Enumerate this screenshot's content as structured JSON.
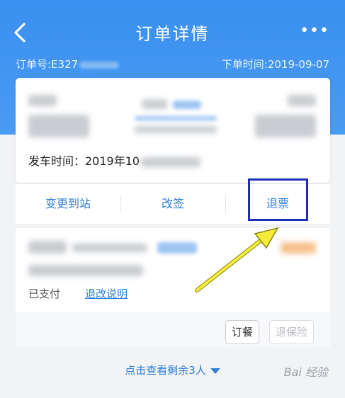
{
  "header": {
    "title": "订单详情",
    "more": "•••",
    "order_no_label": "订单号:E327",
    "order_time_label": "下单时间:2019-09-07"
  },
  "card": {
    "departure_label": "发车时间：2019年10"
  },
  "actions": {
    "change_station": "变更到站",
    "reschedule": "改签",
    "refund": "退票"
  },
  "passenger": {
    "status": "已支付",
    "refund_info_link": "退改说明"
  },
  "buttons": {
    "meal": "订餐",
    "insurance_refund": "退保险"
  },
  "footer": {
    "view_more": "点击查看剩余3人"
  },
  "watermark": "Bai 经验",
  "colors": {
    "header_blue": "#3a8ff0",
    "link_blue": "#2d7fd8",
    "highlight_border": "#1a2fb5",
    "annotation_arrow": "#f4ec3a"
  }
}
